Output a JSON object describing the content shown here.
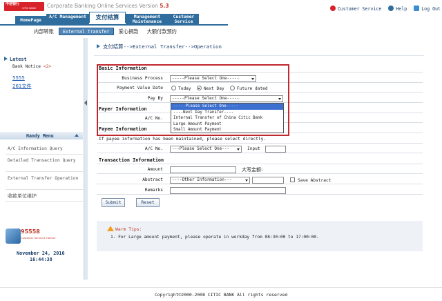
{
  "header": {
    "app_title": "Corporate Banking Online Services Version",
    "version": "5.3",
    "logo_text": "中信银行",
    "logo_sub": "CITIC BANK"
  },
  "topnav": [
    {
      "label": "HomePage"
    },
    {
      "label": "A/C Management"
    },
    {
      "label": "支付结算"
    },
    {
      "label": "Management Maintenance"
    },
    {
      "label": "Customer Service"
    }
  ],
  "top_right": {
    "customer_service": "Customer Service",
    "help": "Help",
    "log_out": "Log Out"
  },
  "subnav": [
    {
      "label": "内部转账"
    },
    {
      "label": "External Transfer"
    },
    {
      "label": "爱心捐款"
    },
    {
      "label": "大额付款预约"
    }
  ],
  "sidebar": {
    "latest": "Latest",
    "bank_notice": "Bank Notice",
    "notice_count": "<2>",
    "links": [
      "5555",
      "261文件"
    ],
    "handy_menu": "Handy Menu",
    "menu": [
      "A/C Information Query",
      "Detailed Transaction Query",
      "External Transfer Operation",
      "收款单位维护"
    ],
    "hotline": "95558",
    "hotline_caption": "Customer Services Hotline",
    "date": "November 24, 2016",
    "time": "16:44:38"
  },
  "breadcrumb": "支付结算-->External Transfer-->Operation",
  "form": {
    "basic_info": "Basic Information",
    "business_process_label": "Business Process",
    "business_process_value": "-----Please Select One-----",
    "payment_date_label": "Payment Value Date",
    "date_options": [
      "Today",
      "Next Day",
      "Future dated"
    ],
    "pay_by_label": "Pay By",
    "pay_by_value": "-----Please Select One-----",
    "payer_info": "Payer Information",
    "payer_ac_label": "A/C No.",
    "payee_info": "Payee Information",
    "payee_hint": "If payee information has been maintained, please select directly.",
    "payee_ac_label": "A/C No.",
    "payee_ac_value": "---Please Select One---",
    "input_label": "Input",
    "txn_info": "Transaction Information",
    "amount_label": "Amount",
    "amount_cn_label": "大写金额:",
    "abstract_label": "Abstract",
    "abstract_value": "----Other Information---",
    "save_abstract": "Save Abstract",
    "remarks_label": "Remarks",
    "submit": "Submit",
    "reset": "Reset"
  },
  "pay_by_options": [
    "-----Please Select One-----",
    "----Next Day Transfer----",
    "Internal Transfer of China Citic Bank",
    "Large Amount Payment",
    "Small Amount Payment"
  ],
  "tips": {
    "title": "Warm Tips:",
    "line": "1.  For Large amount payment, please operate in workday from 08:30:00 to 17:00:00."
  },
  "footer": "Copyright©2000-2008 CITIC BANK All rights reserved",
  "colors": {
    "brand_red": "#d8222a",
    "nav_blue": "#2f6d9e",
    "highlight_box": "#c0282d",
    "dropdown_highlight": "#3b6fd0"
  }
}
